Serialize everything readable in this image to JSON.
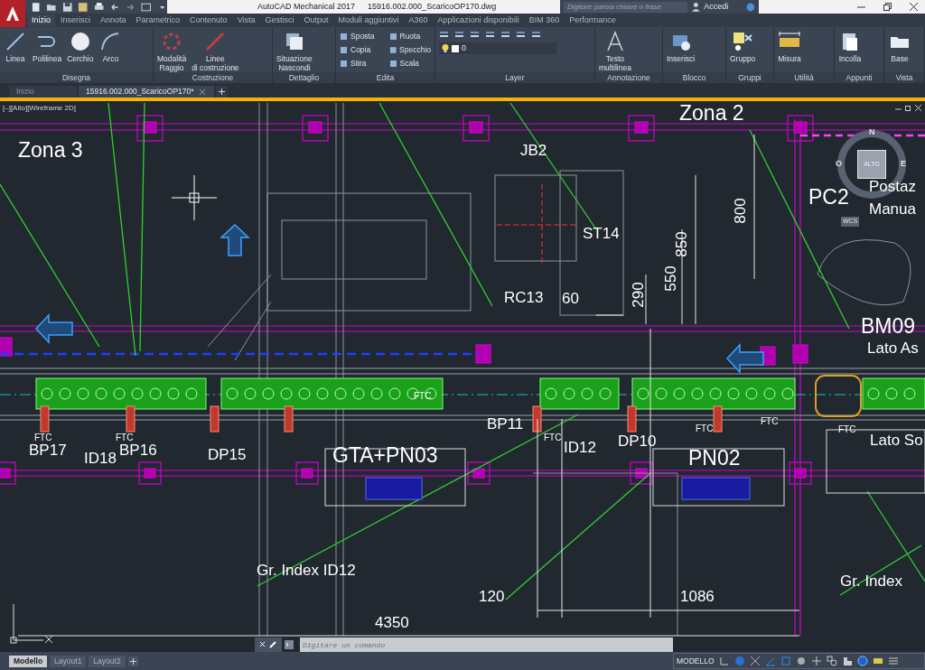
{
  "title_bar": {
    "app_title": "AutoCAD Mechanical 2017",
    "file_name": "15916.002.000_ScaricoOP170.dwg",
    "search_placeholder": "Digitare parola chiave o frase",
    "sign_in": "Accedi"
  },
  "ribbon_tabs": [
    {
      "label": "Inizio",
      "selected": true
    },
    {
      "label": "Inserisci",
      "selected": false
    },
    {
      "label": "Annota",
      "selected": false
    },
    {
      "label": "Parametrico",
      "selected": false
    },
    {
      "label": "Contenuto",
      "selected": false
    },
    {
      "label": "Vista",
      "selected": false
    },
    {
      "label": "Gestisci",
      "selected": false
    },
    {
      "label": "Output",
      "selected": false
    },
    {
      "label": "Moduli aggiuntivi",
      "selected": false
    },
    {
      "label": "A360",
      "selected": false
    },
    {
      "label": "Applicazioni disponibili",
      "selected": false
    },
    {
      "label": "BIM 360",
      "selected": false
    },
    {
      "label": "Performance",
      "selected": false
    }
  ],
  "ribbon_panels": [
    {
      "title": "Disegna",
      "tools": [
        {
          "kind": "large",
          "label": "Linea"
        },
        {
          "kind": "large",
          "label": "Polilinea"
        },
        {
          "kind": "large",
          "label": "Cerchio"
        },
        {
          "kind": "large",
          "label": "Arco"
        }
      ]
    },
    {
      "title": "Costruzione",
      "tools": [
        {
          "kind": "large",
          "label": "Modalità\nRaggio"
        },
        {
          "kind": "large",
          "label": "Linee\ndi costruzione"
        }
      ]
    },
    {
      "title": "Dettaglio",
      "tools": [
        {
          "kind": "large",
          "label": "Situazione\nNascondi"
        }
      ]
    },
    {
      "title": "Edita",
      "tools": [
        {
          "kind": "small",
          "label": "Sposta"
        },
        {
          "kind": "small",
          "label": "Ruota"
        },
        {
          "kind": "small",
          "label": "Copia"
        },
        {
          "kind": "small",
          "label": "Specchio"
        },
        {
          "kind": "small",
          "label": "Stira"
        },
        {
          "kind": "small",
          "label": "Scala"
        }
      ]
    },
    {
      "title": "Layer",
      "tools": [
        {
          "kind": "dropdown",
          "label": "0"
        }
      ]
    },
    {
      "title": "Annotazione",
      "tools": [
        {
          "kind": "large",
          "label": "Testo\nmultilinea"
        }
      ]
    },
    {
      "title": "Blocco",
      "tools": [
        {
          "kind": "large",
          "label": "Inserisci"
        }
      ]
    },
    {
      "title": "Gruppi",
      "tools": [
        {
          "kind": "large",
          "label": "Gruppo"
        }
      ]
    },
    {
      "title": "Utilità",
      "tools": [
        {
          "kind": "large",
          "label": "Misura"
        }
      ]
    },
    {
      "title": "Appunti",
      "tools": [
        {
          "kind": "large",
          "label": "Incolla"
        }
      ]
    },
    {
      "title": "Vista",
      "tools": [
        {
          "kind": "large",
          "label": "Base"
        }
      ]
    }
  ],
  "document_tabs": [
    {
      "label": "Inizio",
      "selected": false
    },
    {
      "label": "15916.002.000_ScaricoOP170*",
      "selected": true
    }
  ],
  "viewport_label": "[–][Alto][Wireframe 2D]",
  "viewcube": {
    "top": "ALTO",
    "north": "N",
    "west": "O",
    "east": "E",
    "ucs": "WCS"
  },
  "drawing_labels": [
    {
      "text": "Zona 3",
      "kind": "title"
    },
    {
      "text": "Zona 2",
      "kind": "title"
    },
    {
      "text": "JB2",
      "kind": "label"
    },
    {
      "text": "ST14",
      "kind": "label"
    },
    {
      "text": "PC2",
      "kind": "title"
    },
    {
      "text": "Postaz",
      "kind": "label"
    },
    {
      "text": "Manua",
      "kind": "label"
    },
    {
      "text": "800",
      "kind": "vertical"
    },
    {
      "text": "850",
      "kind": "vertical"
    },
    {
      "text": "550",
      "kind": "vertical"
    },
    {
      "text": "290",
      "kind": "vertical"
    },
    {
      "text": "60",
      "kind": "label"
    },
    {
      "text": "RC13",
      "kind": "label"
    },
    {
      "text": "BM09",
      "kind": "title"
    },
    {
      "text": "Lato As",
      "kind": "label"
    },
    {
      "text": "FTC",
      "kind": "small"
    },
    {
      "text": "BP11",
      "kind": "label"
    },
    {
      "text": "FTC",
      "kind": "small"
    },
    {
      "text": "ID12",
      "kind": "label"
    },
    {
      "text": "FTC",
      "kind": "small"
    },
    {
      "text": "DP10",
      "kind": "label"
    },
    {
      "text": "FTC",
      "kind": "small"
    },
    {
      "text": "FTC",
      "kind": "small"
    },
    {
      "text": "Lato So",
      "kind": "label"
    },
    {
      "text": "FTC",
      "kind": "small"
    },
    {
      "text": "BP17",
      "kind": "label"
    },
    {
      "text": "FTC",
      "kind": "small"
    },
    {
      "text": "ID18",
      "kind": "label"
    },
    {
      "text": "BP16",
      "kind": "label"
    },
    {
      "text": "DP15",
      "kind": "label"
    },
    {
      "text": "GTA+PN03",
      "kind": "title"
    },
    {
      "text": "PN02",
      "kind": "title"
    },
    {
      "text": "Gr. Index ID12",
      "kind": "label"
    },
    {
      "text": "Gr. Index",
      "kind": "label"
    },
    {
      "text": "120",
      "kind": "label"
    },
    {
      "text": "1086",
      "kind": "label"
    },
    {
      "text": "4350",
      "kind": "label"
    }
  ],
  "command_line": {
    "placeholder": "Digitare un comando"
  },
  "layout_tabs": [
    {
      "label": "Modello",
      "selected": true
    },
    {
      "label": "Layout1",
      "selected": false
    },
    {
      "label": "Layout2",
      "selected": false
    }
  ],
  "status_bar": {
    "space": "MODELLO"
  }
}
